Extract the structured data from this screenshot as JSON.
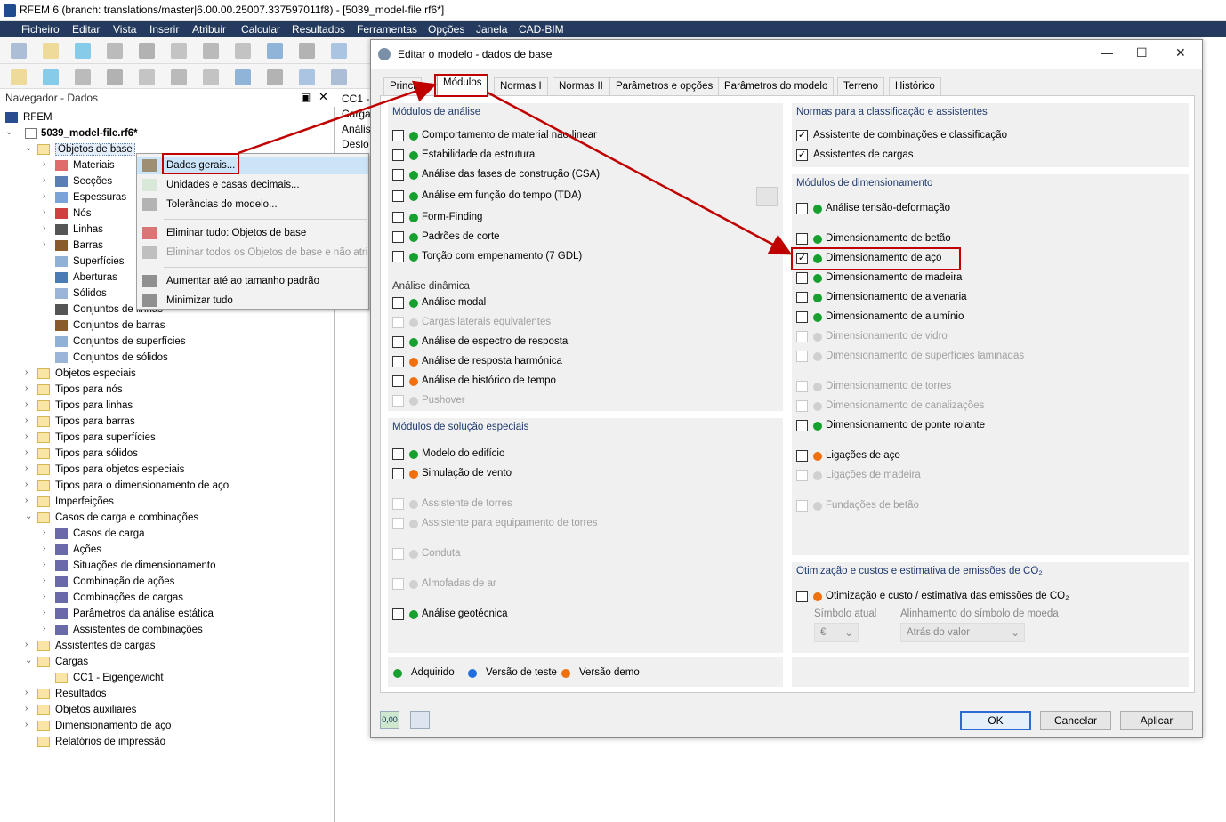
{
  "window": {
    "title": "RFEM 6 (branch: translations/master|6.00.00.25007.337597011f8) - [5039_model-file.rf6*]"
  },
  "menu": [
    "Ficheiro",
    "Editar",
    "Vista",
    "Inserir",
    "Atribuir",
    "Calcular",
    "Resultados",
    "Ferramentas",
    "Opções",
    "Janela",
    "CAD-BIM"
  ],
  "navigator": {
    "title": "Navegador - Dados",
    "root": "RFEM",
    "file": "5039_model-file.rf6*",
    "items": [
      {
        "label": "Objetos de base",
        "level": 1,
        "type": "folder",
        "expand": "open"
      },
      {
        "label": "Materiais",
        "level": 2,
        "type": "materials",
        "expand": "closed"
      },
      {
        "label": "Secções",
        "level": 2,
        "type": "sections",
        "expand": "closed"
      },
      {
        "label": "Espessuras",
        "level": 2,
        "type": "thickness",
        "expand": "closed"
      },
      {
        "label": "Nós",
        "level": 2,
        "type": "nodes",
        "expand": "closed"
      },
      {
        "label": "Linhas",
        "level": 2,
        "type": "lines",
        "expand": "closed"
      },
      {
        "label": "Barras",
        "level": 2,
        "type": "members",
        "expand": "closed"
      },
      {
        "label": "Superfícies",
        "level": 2,
        "type": "surfaces",
        "expand": "none"
      },
      {
        "label": "Aberturas",
        "level": 2,
        "type": "openings",
        "expand": "none"
      },
      {
        "label": "Sólidos",
        "level": 2,
        "type": "solids",
        "expand": "none"
      },
      {
        "label": "Conjuntos de linhas",
        "level": 2,
        "type": "lines",
        "expand": "none"
      },
      {
        "label": "Conjuntos de barras",
        "level": 2,
        "type": "members",
        "expand": "none"
      },
      {
        "label": "Conjuntos de superfícies",
        "level": 2,
        "type": "surfaces",
        "expand": "none"
      },
      {
        "label": "Conjuntos de sólidos",
        "level": 2,
        "type": "solids",
        "expand": "none"
      },
      {
        "label": "Objetos especiais",
        "level": 1,
        "type": "folder",
        "expand": "closed"
      },
      {
        "label": "Tipos para nós",
        "level": 1,
        "type": "folder",
        "expand": "closed"
      },
      {
        "label": "Tipos para linhas",
        "level": 1,
        "type": "folder",
        "expand": "closed"
      },
      {
        "label": "Tipos para barras",
        "level": 1,
        "type": "folder",
        "expand": "closed"
      },
      {
        "label": "Tipos para superfícies",
        "level": 1,
        "type": "folder",
        "expand": "closed"
      },
      {
        "label": "Tipos para sólidos",
        "level": 1,
        "type": "folder",
        "expand": "closed"
      },
      {
        "label": "Tipos para objetos especiais",
        "level": 1,
        "type": "folder",
        "expand": "closed"
      },
      {
        "label": "Tipos para o dimensionamento de aço",
        "level": 1,
        "type": "folder",
        "expand": "closed"
      },
      {
        "label": "Imperfeições",
        "level": 1,
        "type": "folder",
        "expand": "closed"
      },
      {
        "label": "Casos de carga e combinações",
        "level": 1,
        "type": "folder",
        "expand": "open"
      },
      {
        "label": "Casos de carga",
        "level": 2,
        "type": "loadcase",
        "expand": "closed"
      },
      {
        "label": "Ações",
        "level": 2,
        "type": "loadcase",
        "expand": "closed"
      },
      {
        "label": "Situações de dimensionamento",
        "level": 2,
        "type": "loadcase",
        "expand": "closed"
      },
      {
        "label": "Combinação de ações",
        "level": 2,
        "type": "loadcase",
        "expand": "closed"
      },
      {
        "label": "Combinações de cargas",
        "level": 2,
        "type": "loadcase",
        "expand": "closed"
      },
      {
        "label": "Parâmetros da análise estática",
        "level": 2,
        "type": "loadcase",
        "expand": "closed"
      },
      {
        "label": "Assistentes de combinações",
        "level": 2,
        "type": "loadcase",
        "expand": "closed"
      },
      {
        "label": "Assistentes de cargas",
        "level": 1,
        "type": "folder",
        "expand": "closed"
      },
      {
        "label": "Cargas",
        "level": 1,
        "type": "folder",
        "expand": "open"
      },
      {
        "label": "CC1 - Eigengewicht",
        "level": 2,
        "type": "folder",
        "expand": "none"
      },
      {
        "label": "Resultados",
        "level": 1,
        "type": "folder",
        "expand": "closed"
      },
      {
        "label": "Objetos auxiliares",
        "level": 1,
        "type": "folder",
        "expand": "closed"
      },
      {
        "label": "Dimensionamento de aço",
        "level": 1,
        "type": "folder",
        "expand": "closed"
      },
      {
        "label": "Relatórios de impressão",
        "level": 1,
        "type": "folder",
        "expand": "none"
      }
    ]
  },
  "background_strip": [
    "CC1 -",
    "Carga",
    "Anális",
    "Deslo"
  ],
  "context_menu": [
    {
      "label": "Dados gerais...",
      "enabled": true,
      "highlight": true
    },
    {
      "label": "Unidades e casas decimais...",
      "enabled": true
    },
    {
      "label": "Tolerâncias do modelo...",
      "enabled": true
    },
    {
      "sep": true
    },
    {
      "label": "Eliminar tudo: Objetos de base",
      "enabled": true
    },
    {
      "label": "Eliminar todos os Objetos de base e não atri",
      "enabled": false
    },
    {
      "sep": true
    },
    {
      "label": "Aumentar até ao tamanho padrão",
      "enabled": true
    },
    {
      "label": "Minimizar tudo",
      "enabled": true
    }
  ],
  "dialog": {
    "title": "Editar o modelo - dados de base",
    "tabs": [
      "Princi",
      "Módulos",
      "Normas I",
      "Normas II",
      "Parâmetros e opções",
      "Parâmetros do modelo",
      "Terreno",
      "Histórico"
    ],
    "active_tab": 1,
    "left": {
      "analysis_title": "Módulos de análise",
      "analysis": [
        {
          "label": "Comportamento de material não-linear",
          "status": "acquired",
          "checked": false,
          "enabled": true
        },
        {
          "label": "Estabilidade da estrutura",
          "status": "acquired",
          "checked": false,
          "enabled": true
        },
        {
          "label": "Análise das fases de construção (CSA)",
          "status": "acquired",
          "checked": false,
          "enabled": true
        },
        {
          "label": "Análise em função do tempo (TDA)",
          "status": "acquired",
          "checked": false,
          "enabled": true
        },
        {
          "label": "Form-Finding",
          "status": "acquired",
          "checked": false,
          "enabled": true
        },
        {
          "label": "Padrões de corte",
          "status": "acquired",
          "checked": false,
          "enabled": true
        },
        {
          "label": "Torção com empenamento (7 GDL)",
          "status": "acquired",
          "checked": false,
          "enabled": true
        }
      ],
      "dynamic_title": "Análise dinâmica",
      "dynamic": [
        {
          "label": "Análise modal",
          "status": "acquired",
          "checked": false,
          "enabled": true
        },
        {
          "label": "Cargas laterais equivalentes",
          "status": "none",
          "checked": false,
          "enabled": false
        },
        {
          "label": "Análise de espectro de resposta",
          "status": "acquired",
          "checked": false,
          "enabled": true
        },
        {
          "label": "Análise de resposta harmónica",
          "status": "demo",
          "checked": false,
          "enabled": true
        },
        {
          "label": "Análise de histórico de tempo",
          "status": "demo",
          "checked": false,
          "enabled": true
        },
        {
          "label": "Pushover",
          "status": "none",
          "checked": false,
          "enabled": false
        }
      ],
      "special_title": "Módulos de solução especiais",
      "special": [
        {
          "label": "Modelo do edifício",
          "status": "acquired",
          "checked": false,
          "enabled": true
        },
        {
          "label": "Simulação de vento",
          "status": "demo",
          "checked": false,
          "enabled": true
        },
        {
          "label": "Assistente de torres",
          "status": "none",
          "checked": false,
          "enabled": false
        },
        {
          "label": "Assistente para equipamento de torres",
          "status": "none",
          "checked": false,
          "enabled": false
        },
        {
          "label": "Conduta",
          "status": "none",
          "checked": false,
          "enabled": false
        },
        {
          "label": "Almofadas de ar",
          "status": "none",
          "checked": false,
          "enabled": false
        },
        {
          "label": "Análise geotécnica",
          "status": "acquired",
          "checked": false,
          "enabled": true
        }
      ]
    },
    "right": {
      "norms_title": "Normas para a classificação e assistentes",
      "norms": [
        {
          "label": "Assistente de combinações e classificação",
          "checked": true
        },
        {
          "label": "Assistentes de cargas",
          "checked": true
        }
      ],
      "design_title": "Módulos de dimensionamento",
      "design": [
        {
          "label": "Análise tensão-deformação",
          "status": "acquired",
          "checked": false,
          "enabled": true
        },
        {
          "label": "Dimensionamento de betão",
          "status": "acquired",
          "checked": false,
          "enabled": true
        },
        {
          "label": "Dimensionamento de aço",
          "status": "acquired",
          "checked": true,
          "enabled": true
        },
        {
          "label": "Dimensionamento de madeira",
          "status": "acquired",
          "checked": false,
          "enabled": true
        },
        {
          "label": "Dimensionamento de alvenaria",
          "status": "acquired",
          "checked": false,
          "enabled": true
        },
        {
          "label": "Dimensionamento de alumínio",
          "status": "acquired",
          "checked": false,
          "enabled": true
        },
        {
          "label": "Dimensionamento de vidro",
          "status": "none",
          "checked": false,
          "enabled": false
        },
        {
          "label": "Dimensionamento de superfícies laminadas",
          "status": "none",
          "checked": false,
          "enabled": false
        },
        {
          "label": "Dimensionamento de torres",
          "status": "none",
          "checked": false,
          "enabled": false
        },
        {
          "label": "Dimensionamento de canalizações",
          "status": "none",
          "checked": false,
          "enabled": false
        },
        {
          "label": "Dimensionamento de ponte rolante",
          "status": "acquired",
          "checked": false,
          "enabled": true
        },
        {
          "label": "Ligações de aço",
          "status": "demo",
          "checked": false,
          "enabled": true
        },
        {
          "label": "Ligações de madeira",
          "status": "none",
          "checked": false,
          "enabled": false
        },
        {
          "label": "Fundações de betão",
          "status": "none",
          "checked": false,
          "enabled": false
        }
      ],
      "co2_title": "Otimização e custos e estimativa de emissões de CO₂",
      "co2_label": "Otimização e custo / estimativa das emissões de CO₂",
      "symbol_label": "Símbolo atual",
      "symbol_value": "€",
      "align_label": "Alinhamento do símbolo de moeda",
      "align_value": "Atrás do valor"
    },
    "legend": [
      {
        "label": "Adquirido",
        "color": "#16a02e"
      },
      {
        "label": "Versão de teste",
        "color": "#1f6fe0"
      },
      {
        "label": "Versão demo",
        "color": "#f07010"
      }
    ],
    "buttons": {
      "ok": "OK",
      "cancel": "Cancelar",
      "apply": "Aplicar"
    }
  }
}
